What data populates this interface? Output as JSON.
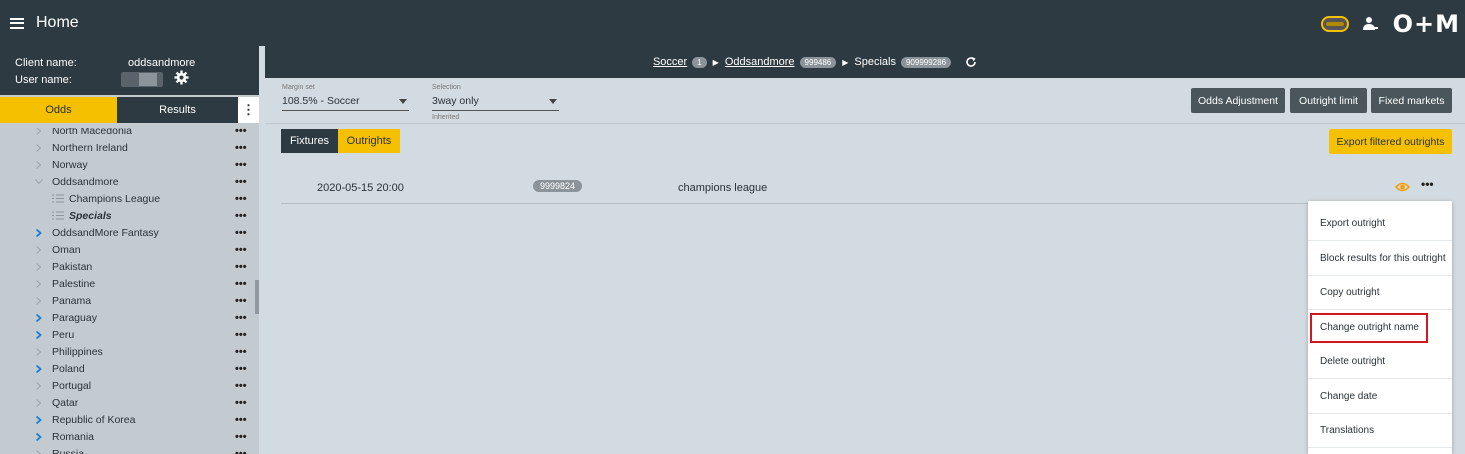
{
  "header": {
    "title": "Home",
    "logo": "O+M"
  },
  "sidebar": {
    "client_label": "Client name:",
    "client_value": "oddsandmore",
    "user_label": "User name:",
    "tabs": {
      "odds": "Odds",
      "results": "Results"
    },
    "items": [
      {
        "label": "North Macedonia",
        "expand": "grey"
      },
      {
        "label": "Northern Ireland",
        "expand": "grey"
      },
      {
        "label": "Norway",
        "expand": "grey"
      },
      {
        "label": "Oddsandmore",
        "expand": "open"
      },
      {
        "label": "Champions League",
        "child": true
      },
      {
        "label": "Specials",
        "child": true,
        "selected": true
      },
      {
        "label": "OddsandMore Fantasy",
        "expand": "blue"
      },
      {
        "label": "Oman",
        "expand": "grey"
      },
      {
        "label": "Pakistan",
        "expand": "grey"
      },
      {
        "label": "Palestine",
        "expand": "grey"
      },
      {
        "label": "Panama",
        "expand": "grey"
      },
      {
        "label": "Paraguay",
        "expand": "blue"
      },
      {
        "label": "Peru",
        "expand": "blue"
      },
      {
        "label": "Philippines",
        "expand": "grey"
      },
      {
        "label": "Poland",
        "expand": "blue"
      },
      {
        "label": "Portugal",
        "expand": "grey"
      },
      {
        "label": "Qatar",
        "expand": "grey"
      },
      {
        "label": "Republic of Korea",
        "expand": "blue"
      },
      {
        "label": "Romania",
        "expand": "blue"
      },
      {
        "label": "Russia",
        "expand": "grey"
      }
    ],
    "dots": "•••"
  },
  "breadcrumb": {
    "sport": "Soccer",
    "sport_count": "1",
    "category": "Oddsandmore",
    "category_id": "999486",
    "tournament": "Specials",
    "tournament_id": "909999286"
  },
  "filters": {
    "margin_label": "Margin set",
    "margin_value": "108.5% - Soccer",
    "selection_label": "Selection",
    "selection_value": "3way only",
    "selection_sub": "Inherited"
  },
  "toolbar": {
    "odds_adjustment": "Odds Adjustment",
    "outright_limit": "Outright limit",
    "fixed_markets": "Fixed markets",
    "export_filtered": "Export filtered outrights"
  },
  "subtabs": {
    "fixtures": "Fixtures",
    "outrights": "Outrights"
  },
  "row": {
    "date": "2020-05-15 20:00",
    "id": "9999824",
    "name": "champions league",
    "dots": "•••"
  },
  "menu": {
    "items": [
      "Export outright",
      "Block results for this outright",
      "Copy outright",
      "Change outright name",
      "Delete outright",
      "Change date",
      "Translations"
    ]
  },
  "colors": {
    "dark": "#2e3a41",
    "accent": "#f5c000",
    "highlight": "#d2161e",
    "link_blue": "#1a7fd4"
  }
}
